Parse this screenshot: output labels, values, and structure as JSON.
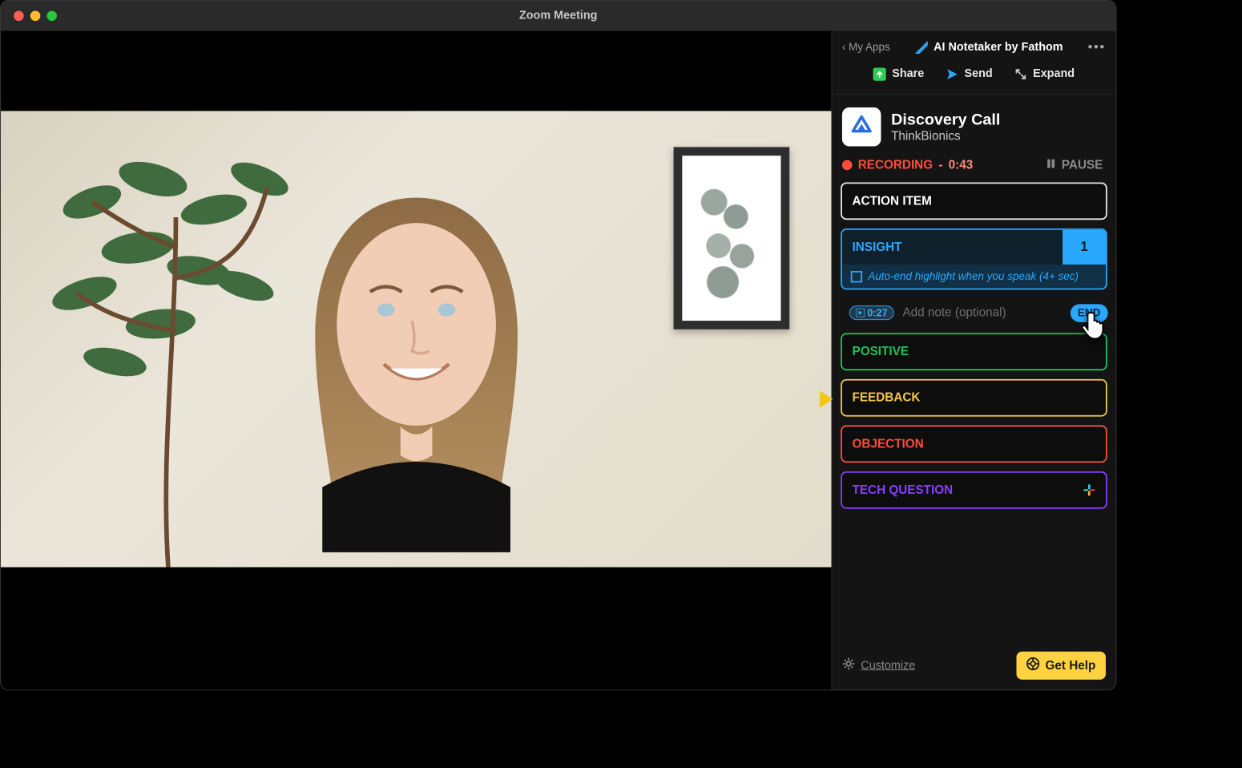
{
  "window": {
    "title": "Zoom Meeting"
  },
  "sidebar": {
    "back_label": "My Apps",
    "app_name": "AI Notetaker by Fathom",
    "actions": {
      "share": "Share",
      "send": "Send",
      "expand": "Expand"
    },
    "meeting": {
      "title": "Discovery Call",
      "company": "ThinkBionics"
    },
    "recording": {
      "label": "RECORDING",
      "separator": "-",
      "time": "0:43",
      "pause": "PAUSE"
    },
    "tags": {
      "action_item": "ACTION ITEM",
      "insight": {
        "label": "INSIGHT",
        "count": "1",
        "auto_end_text": "Auto-end highlight when you speak (4+ sec)"
      },
      "note": {
        "timestamp": "0:27",
        "placeholder": "Add note (optional)",
        "end_label": "END"
      },
      "positive": "POSITIVE",
      "feedback": "FEEDBACK",
      "objection": "OBJECTION",
      "tech_question": "TECH QUESTION"
    },
    "footer": {
      "customize": "Customize",
      "get_help": "Get Help"
    }
  }
}
